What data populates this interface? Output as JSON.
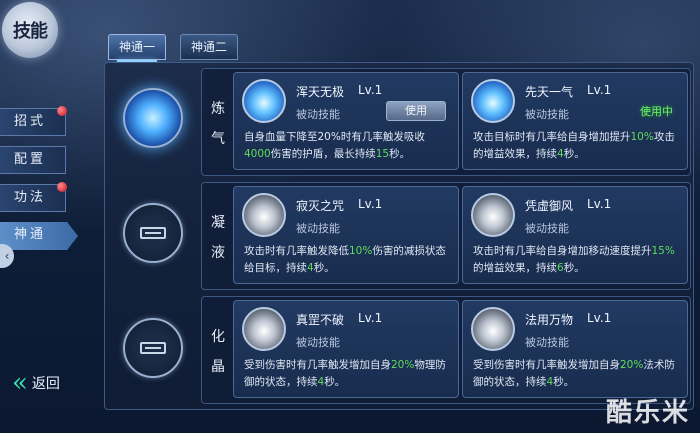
{
  "title": "技能",
  "tabs": [
    {
      "label": "神通一",
      "active": true
    },
    {
      "label": "神通二",
      "active": false
    }
  ],
  "side_menu": [
    {
      "label": "招式",
      "badge": true
    },
    {
      "label": "配置",
      "badge": false
    },
    {
      "label": "功法",
      "badge": true
    },
    {
      "label": "神通",
      "badge": false,
      "active": true
    }
  ],
  "back_label": "返回",
  "rows": [
    {
      "label_chars": [
        "炼",
        "气"
      ],
      "orb_lit": true,
      "skills": [
        {
          "name": "浑天无极",
          "level": "Lv.1",
          "type": "被动技能",
          "button": "使用",
          "status": "",
          "desc_parts": [
            {
              "t": "自身血量下降至20%时有几率触发吸收",
              "g": false
            },
            {
              "t": "4000",
              "g": true
            },
            {
              "t": "伤害的护盾，最长持续",
              "g": false
            },
            {
              "t": "15",
              "g": true
            },
            {
              "t": "秒。",
              "g": false
            }
          ],
          "icon": "blue"
        },
        {
          "name": "先天一气",
          "level": "Lv.1",
          "type": "被动技能",
          "button": "",
          "status": "使用中",
          "desc_parts": [
            {
              "t": "攻击目标时有几率给自身增加提升",
              "g": false
            },
            {
              "t": "10%",
              "g": true
            },
            {
              "t": "攻击的增益效果，持续",
              "g": false
            },
            {
              "t": "4",
              "g": true
            },
            {
              "t": "秒。",
              "g": false
            }
          ],
          "icon": "blue"
        }
      ]
    },
    {
      "label_chars": [
        "凝",
        "液"
      ],
      "orb_lit": false,
      "skills": [
        {
          "name": "寂灭之咒",
          "level": "Lv.1",
          "type": "被动技能",
          "button": "",
          "status": "",
          "desc_parts": [
            {
              "t": "攻击时有几率触发降低",
              "g": false
            },
            {
              "t": "10%",
              "g": true
            },
            {
              "t": "伤害的减损状态给目标，持续",
              "g": false
            },
            {
              "t": "4",
              "g": true
            },
            {
              "t": "秒。",
              "g": false
            }
          ],
          "icon": "grey"
        },
        {
          "name": "凭虚御风",
          "level": "Lv.1",
          "type": "被动技能",
          "button": "",
          "status": "",
          "desc_parts": [
            {
              "t": "攻击时有几率给自身增加移动速度提升",
              "g": false
            },
            {
              "t": "15%",
              "g": true
            },
            {
              "t": "的增益效果，持续",
              "g": false
            },
            {
              "t": "6",
              "g": true
            },
            {
              "t": "秒。",
              "g": false
            }
          ],
          "icon": "grey"
        }
      ]
    },
    {
      "label_chars": [
        "化",
        "晶"
      ],
      "orb_lit": false,
      "skills": [
        {
          "name": "真罡不破",
          "level": "Lv.1",
          "type": "被动技能",
          "button": "",
          "status": "",
          "desc_parts": [
            {
              "t": "受到伤害时有几率触发增加自身",
              "g": false
            },
            {
              "t": "20%",
              "g": true
            },
            {
              "t": "物理防御的状态，持续",
              "g": false
            },
            {
              "t": "4",
              "g": true
            },
            {
              "t": "秒。",
              "g": false
            }
          ],
          "icon": "grey"
        },
        {
          "name": "法用万物",
          "level": "Lv.1",
          "type": "被动技能",
          "button": "",
          "status": "",
          "desc_parts": [
            {
              "t": "受到伤害时有几率触发增加自身",
              "g": false
            },
            {
              "t": "20%",
              "g": true
            },
            {
              "t": "法术防御的状态，持续",
              "g": false
            },
            {
              "t": "4",
              "g": true
            },
            {
              "t": "秒。",
              "g": false
            }
          ],
          "icon": "grey"
        }
      ]
    }
  ],
  "watermark": "酷乐米"
}
